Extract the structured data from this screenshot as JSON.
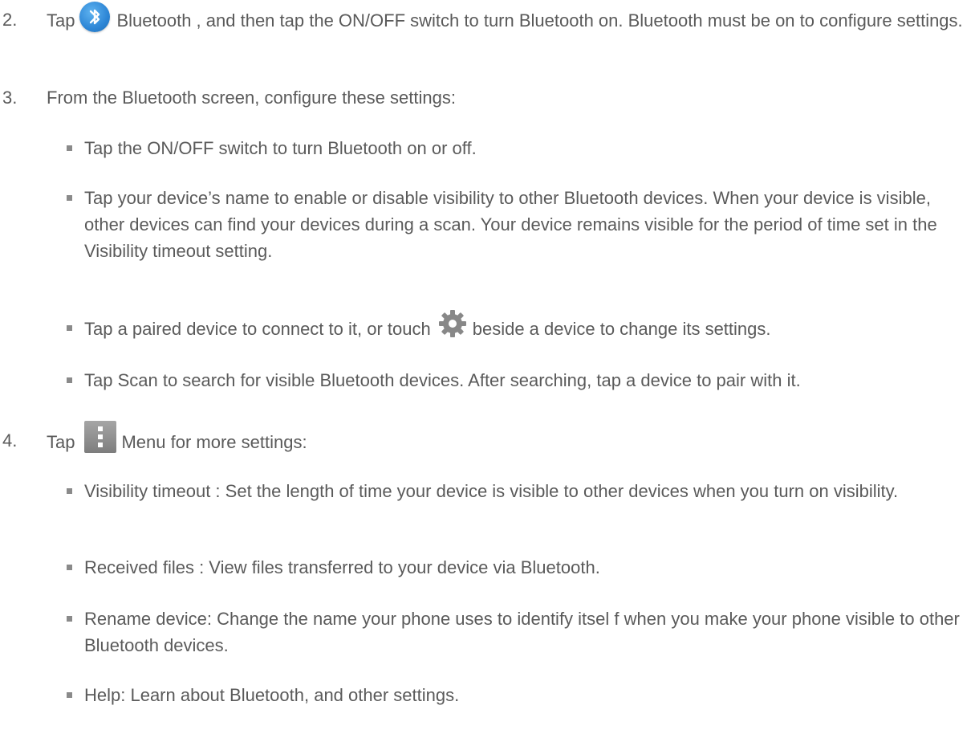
{
  "steps": [
    {
      "number": "2.",
      "before_icon": "Tap",
      "icon": "bluetooth-icon",
      "after_icon": "Bluetooth , and then tap the ON/OFF switch to turn Bluetooth on. Bluetooth must be on to configure settings."
    },
    {
      "number": "3.",
      "text": "From the Bluetooth screen, configure these settings:",
      "bullets": [
        "Tap the ON/OFF switch to turn Bluetooth on or off.",
        "Tap your device’s name to enable or disable visibility to other Bluetooth devices. When your device is visible, other devices can find your devices during a scan. Your device remains visible for the period of time set in the Visibility timeout setting.",
        {
          "before_icon": "Tap a paired device to connect to it, or touch",
          "icon": "gear-icon",
          "after_icon": "beside a device to change its settings."
        },
        "Tap Scan to search for visible Bluetooth devices. After searching, tap a device to pair with it."
      ]
    },
    {
      "number": "4.",
      "before_icon": "Tap",
      "icon": "menu-icon",
      "after_icon": "Menu for more settings:",
      "bullets": [
        "Visibility timeout : Set the length of time your device is visible to other devices when you turn on visibility.",
        "Received files : View files transferred to your device via Bluetooth.",
        "Rename device: Change the name your phone uses to identify itsel f when you make your phone visible to other Bluetooth devices.",
        "Help: Learn about Bluetooth, and other settings."
      ]
    }
  ],
  "colors": {
    "text": "#5a5a5a",
    "bullet": "#8a8a8a",
    "bluetooth_blue": "#2d86d6"
  }
}
